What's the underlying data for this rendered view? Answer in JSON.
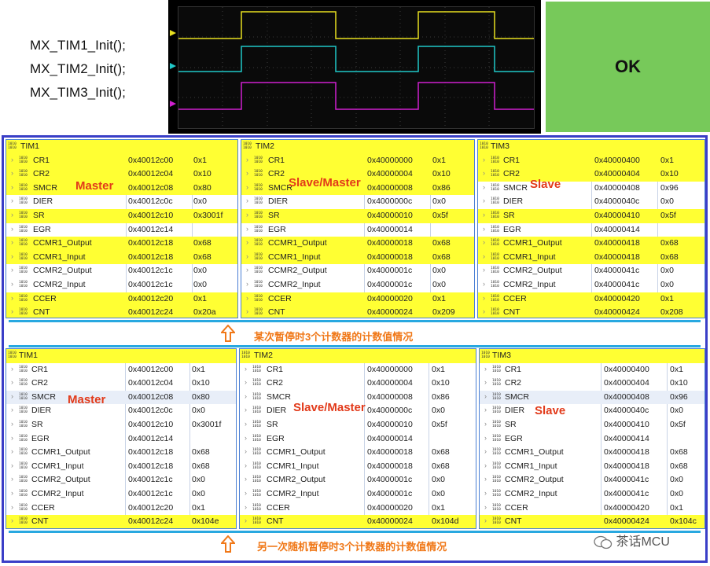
{
  "code": [
    "MX_TIM1_Init();",
    "MX_TIM2_Init();",
    "MX_TIM3_Init();"
  ],
  "ok_label": "OK",
  "top": {
    "tim1": {
      "title": "TIM1",
      "role": "Master",
      "rows": [
        {
          "name": "CR1",
          "addr": "0x40012c00",
          "val": "0x1",
          "hl": true
        },
        {
          "name": "CR2",
          "addr": "0x40012c04",
          "val": "0x10",
          "hl": true
        },
        {
          "name": "SMCR",
          "addr": "0x40012c08",
          "val": "0x80",
          "hl": true
        },
        {
          "name": "DIER",
          "addr": "0x40012c0c",
          "val": "0x0",
          "hl": false
        },
        {
          "name": "SR",
          "addr": "0x40012c10",
          "val": "0x3001f",
          "hl": true
        },
        {
          "name": "EGR",
          "addr": "0x40012c14",
          "val": "",
          "hl": false
        },
        {
          "name": "CCMR1_Output",
          "addr": "0x40012c18",
          "val": "0x68",
          "hl": true
        },
        {
          "name": "CCMR1_Input",
          "addr": "0x40012c18",
          "val": "0x68",
          "hl": true
        },
        {
          "name": "CCMR2_Output",
          "addr": "0x40012c1c",
          "val": "0x0",
          "hl": false
        },
        {
          "name": "CCMR2_Input",
          "addr": "0x40012c1c",
          "val": "0x0",
          "hl": false
        },
        {
          "name": "CCER",
          "addr": "0x40012c20",
          "val": "0x1",
          "hl": true
        },
        {
          "name": "CNT",
          "addr": "0x40012c24",
          "val": "0x20a",
          "hl": true
        }
      ]
    },
    "tim2": {
      "title": "TIM2",
      "role": "Slave/Master",
      "rows": [
        {
          "name": "CR1",
          "addr": "0x40000000",
          "val": "0x1",
          "hl": true
        },
        {
          "name": "CR2",
          "addr": "0x40000004",
          "val": "0x10",
          "hl": true
        },
        {
          "name": "SMCR",
          "addr": "0x40000008",
          "val": "0x86",
          "hl": true
        },
        {
          "name": "DIER",
          "addr": "0x4000000c",
          "val": "0x0",
          "hl": false
        },
        {
          "name": "SR",
          "addr": "0x40000010",
          "val": "0x5f",
          "hl": true
        },
        {
          "name": "EGR",
          "addr": "0x40000014",
          "val": "",
          "hl": false
        },
        {
          "name": "CCMR1_Output",
          "addr": "0x40000018",
          "val": "0x68",
          "hl": true
        },
        {
          "name": "CCMR1_Input",
          "addr": "0x40000018",
          "val": "0x68",
          "hl": true
        },
        {
          "name": "CCMR2_Output",
          "addr": "0x4000001c",
          "val": "0x0",
          "hl": false
        },
        {
          "name": "CCMR2_Input",
          "addr": "0x4000001c",
          "val": "0x0",
          "hl": false
        },
        {
          "name": "CCER",
          "addr": "0x40000020",
          "val": "0x1",
          "hl": true
        },
        {
          "name": "CNT",
          "addr": "0x40000024",
          "val": "0x209",
          "hl": true
        }
      ]
    },
    "tim3": {
      "title": "TIM3",
      "role": "Slave",
      "rows": [
        {
          "name": "CR1",
          "addr": "0x40000400",
          "val": "0x1",
          "hl": true
        },
        {
          "name": "CR2",
          "addr": "0x40000404",
          "val": "0x10",
          "hl": true
        },
        {
          "name": "SMCR",
          "addr": "0x40000408",
          "val": "0x96",
          "hl": false
        },
        {
          "name": "DIER",
          "addr": "0x4000040c",
          "val": "0x0",
          "hl": false
        },
        {
          "name": "SR",
          "addr": "0x40000410",
          "val": "0x5f",
          "hl": true
        },
        {
          "name": "EGR",
          "addr": "0x40000414",
          "val": "",
          "hl": false
        },
        {
          "name": "CCMR1_Output",
          "addr": "0x40000418",
          "val": "0x68",
          "hl": true
        },
        {
          "name": "CCMR1_Input",
          "addr": "0x40000418",
          "val": "0x68",
          "hl": true
        },
        {
          "name": "CCMR2_Output",
          "addr": "0x4000041c",
          "val": "0x0",
          "hl": false
        },
        {
          "name": "CCMR2_Input",
          "addr": "0x4000041c",
          "val": "0x0",
          "hl": false
        },
        {
          "name": "CCER",
          "addr": "0x40000420",
          "val": "0x1",
          "hl": true
        },
        {
          "name": "CNT",
          "addr": "0x40000424",
          "val": "0x208",
          "hl": true
        }
      ]
    }
  },
  "top_caption": "某次暂停时3个计数器的计数值情况",
  "bottom": {
    "tim1": {
      "title": "TIM1",
      "role": "Master",
      "rows": [
        {
          "name": "CR1",
          "addr": "0x40012c00",
          "val": "0x1",
          "hl": false
        },
        {
          "name": "CR2",
          "addr": "0x40012c04",
          "val": "0x10",
          "hl": false
        },
        {
          "name": "SMCR",
          "addr": "0x40012c08",
          "val": "0x80",
          "hl": false,
          "grey": true
        },
        {
          "name": "DIER",
          "addr": "0x40012c0c",
          "val": "0x0",
          "hl": false
        },
        {
          "name": "SR",
          "addr": "0x40012c10",
          "val": "0x3001f",
          "hl": false
        },
        {
          "name": "EGR",
          "addr": "0x40012c14",
          "val": "",
          "hl": false
        },
        {
          "name": "CCMR1_Output",
          "addr": "0x40012c18",
          "val": "0x68",
          "hl": false
        },
        {
          "name": "CCMR1_Input",
          "addr": "0x40012c18",
          "val": "0x68",
          "hl": false
        },
        {
          "name": "CCMR2_Output",
          "addr": "0x40012c1c",
          "val": "0x0",
          "hl": false
        },
        {
          "name": "CCMR2_Input",
          "addr": "0x40012c1c",
          "val": "0x0",
          "hl": false
        },
        {
          "name": "CCER",
          "addr": "0x40012c20",
          "val": "0x1",
          "hl": false
        },
        {
          "name": "CNT",
          "addr": "0x40012c24",
          "val": "0x104e",
          "hl": true
        }
      ]
    },
    "tim2": {
      "title": "TIM2",
      "role": "Slave/Master",
      "rows": [
        {
          "name": "CR1",
          "addr": "0x40000000",
          "val": "0x1",
          "hl": false
        },
        {
          "name": "CR2",
          "addr": "0x40000004",
          "val": "0x10",
          "hl": false
        },
        {
          "name": "SMCR",
          "addr": "0x40000008",
          "val": "0x86",
          "hl": false
        },
        {
          "name": "DIER",
          "addr": "0x4000000c",
          "val": "0x0",
          "hl": false
        },
        {
          "name": "SR",
          "addr": "0x40000010",
          "val": "0x5f",
          "hl": false
        },
        {
          "name": "EGR",
          "addr": "0x40000014",
          "val": "",
          "hl": false
        },
        {
          "name": "CCMR1_Output",
          "addr": "0x40000018",
          "val": "0x68",
          "hl": false
        },
        {
          "name": "CCMR1_Input",
          "addr": "0x40000018",
          "val": "0x68",
          "hl": false
        },
        {
          "name": "CCMR2_Output",
          "addr": "0x4000001c",
          "val": "0x0",
          "hl": false
        },
        {
          "name": "CCMR2_Input",
          "addr": "0x4000001c",
          "val": "0x0",
          "hl": false
        },
        {
          "name": "CCER",
          "addr": "0x40000020",
          "val": "0x1",
          "hl": false
        },
        {
          "name": "CNT",
          "addr": "0x40000024",
          "val": "0x104d",
          "hl": true
        }
      ]
    },
    "tim3": {
      "title": "TIM3",
      "role": "Slave",
      "rows": [
        {
          "name": "CR1",
          "addr": "0x40000400",
          "val": "0x1",
          "hl": false
        },
        {
          "name": "CR2",
          "addr": "0x40000404",
          "val": "0x10",
          "hl": false
        },
        {
          "name": "SMCR",
          "addr": "0x40000408",
          "val": "0x96",
          "hl": false,
          "grey": true
        },
        {
          "name": "DIER",
          "addr": "0x4000040c",
          "val": "0x0",
          "hl": false
        },
        {
          "name": "SR",
          "addr": "0x40000410",
          "val": "0x5f",
          "hl": false
        },
        {
          "name": "EGR",
          "addr": "0x40000414",
          "val": "",
          "hl": false
        },
        {
          "name": "CCMR1_Output",
          "addr": "0x40000418",
          "val": "0x68",
          "hl": false
        },
        {
          "name": "CCMR1_Input",
          "addr": "0x40000418",
          "val": "0x68",
          "hl": false
        },
        {
          "name": "CCMR2_Output",
          "addr": "0x4000041c",
          "val": "0x0",
          "hl": false
        },
        {
          "name": "CCMR2_Input",
          "addr": "0x4000041c",
          "val": "0x0",
          "hl": false
        },
        {
          "name": "CCER",
          "addr": "0x40000420",
          "val": "0x1",
          "hl": false
        },
        {
          "name": "CNT",
          "addr": "0x40000424",
          "val": "0x104c",
          "hl": true
        }
      ]
    }
  },
  "bottom_caption": "另一次随机暂停时3个计数器的计数值情况",
  "watermark": "茶话MCU",
  "colors": {
    "highlight": "#ffff33",
    "role": "#e23a1a",
    "caption": "#f07818",
    "border": "#3a3ec7",
    "ok": "#77c95a"
  }
}
